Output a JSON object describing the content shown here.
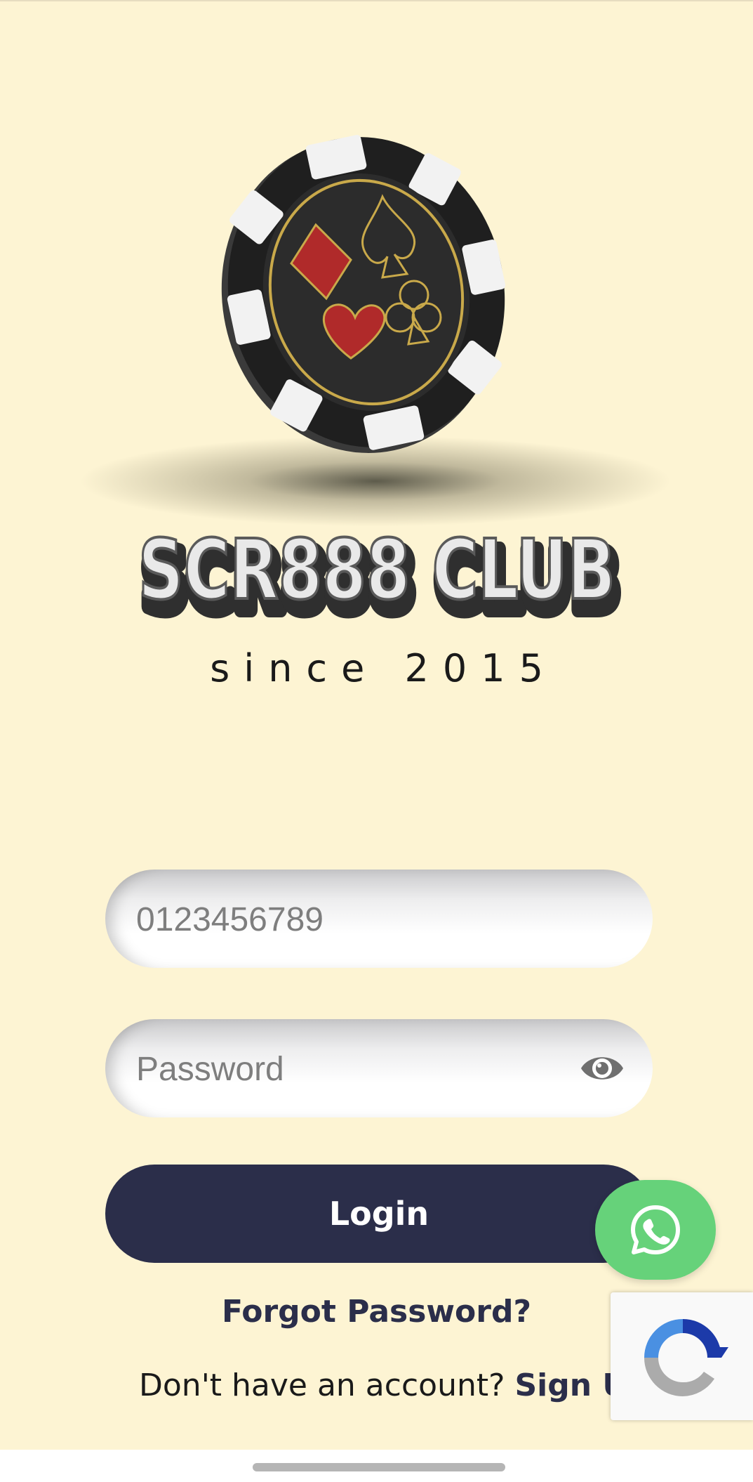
{
  "brand": {
    "title": "SCR888 CLUB",
    "subtitle": "since 2015"
  },
  "form": {
    "phone_placeholder": "0123456789",
    "password_placeholder": "Password",
    "login_label": "Login",
    "forgot_label": "Forgot Password?",
    "signup_prompt": "Don't have an account? ",
    "signup_label": "Sign Up"
  },
  "icons": {
    "logo": "poker-chip-logo-icon",
    "eye": "eye-icon",
    "whatsapp": "whatsapp-icon",
    "recaptcha": "recaptcha-icon"
  },
  "colors": {
    "background": "#fdf4d3",
    "primary": "#2b2e4a",
    "whatsapp": "#66d27a"
  }
}
